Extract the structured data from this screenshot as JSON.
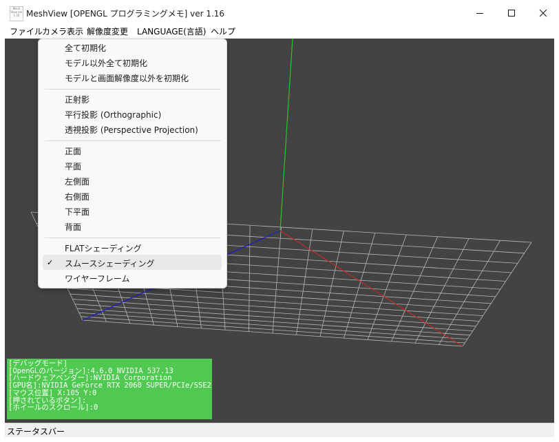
{
  "window": {
    "title": "MeshView [OPENGL プログラミングメモ] ver 1.16",
    "icon_text": "Mesh View ver 1.16"
  },
  "menubar": {
    "file": "ファイル",
    "camera": "カメラ表示",
    "resolution": "解像度変更",
    "language": "LANGUAGE(言語)",
    "help": "ヘルプ"
  },
  "dropdown": {
    "reset_all": "全て初期化",
    "reset_except_model": "モデル以外全て初期化",
    "reset_except_model_resolution": "モデルと画面解像度以外を初期化",
    "ortho_projection": "正射影",
    "parallel_projection": "平行投影 (Orthographic)",
    "perspective_projection": "透視投影 (Perspective Projection)",
    "front": "正面",
    "plane": "平面",
    "left_side": "左側面",
    "right_side": "右側面",
    "bottom_plane": "下平面",
    "back": "背面",
    "flat_shading": "FLATシェーディング",
    "smooth_shading": "スムースシェーディング",
    "smooth_checked": true,
    "wireframe": "ワイヤーフレーム"
  },
  "debug": {
    "mode": "[デバッグモード]",
    "opengl_version": "[OpenGLのバージョン]:4.6.0 NVIDIA 537.13",
    "vendor": "[ハードウェアベンダー]:NVIDIA Corporation",
    "gpu": "[GPU名]:NVIDIA GeForce RTX 2060 SUPER/PCIe/SSE2",
    "mouse": "[マウス位置] X:105 Y:0",
    "pressed": "[押されているボタン]:",
    "wheel": "[ホイールのスクロール]:0"
  },
  "statusbar": {
    "text": "ステータスバー"
  },
  "colors": {
    "viewport_bg": "#434343",
    "grid": "#b8b8b8",
    "axis_x": "#c62828",
    "axis_y": "#22cc22",
    "axis_z": "#1a1ad0",
    "debug_bg": "#4fc94f"
  }
}
